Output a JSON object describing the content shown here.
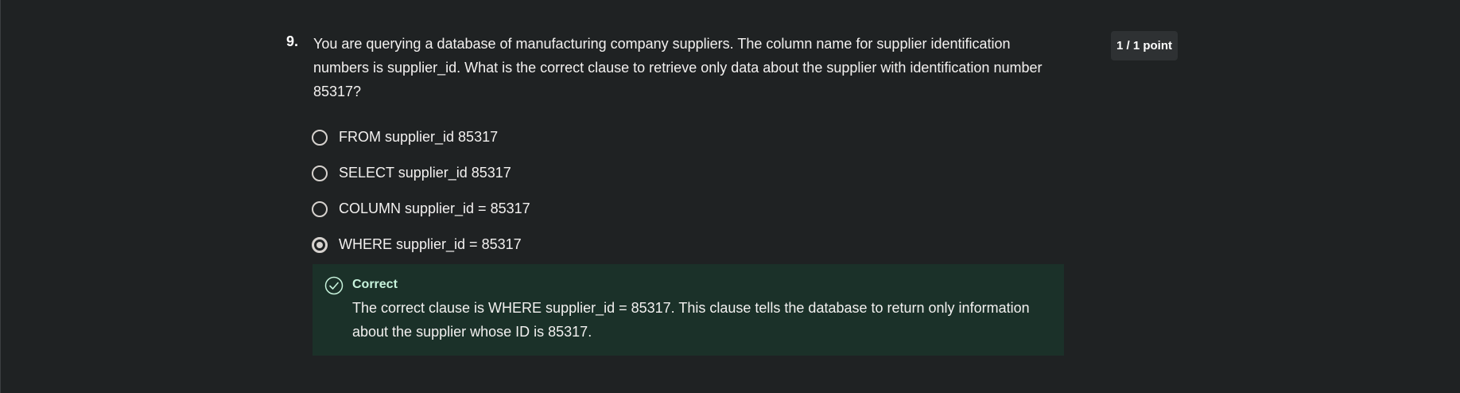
{
  "question": {
    "number": "9.",
    "text": "You are querying a database of manufacturing company suppliers. The column name for supplier identification numbers is supplier_id. What is the correct clause to retrieve only data about the supplier with identification number 85317?",
    "score": "1 / 1 point"
  },
  "options": [
    {
      "label": "FROM supplier_id 85317",
      "selected": false
    },
    {
      "label": "SELECT supplier_id 85317",
      "selected": false
    },
    {
      "label": "COLUMN supplier_id = 85317",
      "selected": false
    },
    {
      "label": "WHERE supplier_id = 85317",
      "selected": true
    }
  ],
  "feedback": {
    "title": "Correct",
    "text": "The correct clause is WHERE supplier_id = 85317. This clause tells the database to return only information about the supplier whose ID is 85317.",
    "icon": "check-circle-icon",
    "color": "#c7f3dc"
  },
  "colors": {
    "background": "#1f2223",
    "feedback_background": "#1b3129",
    "badge_background": "#2e3133"
  }
}
